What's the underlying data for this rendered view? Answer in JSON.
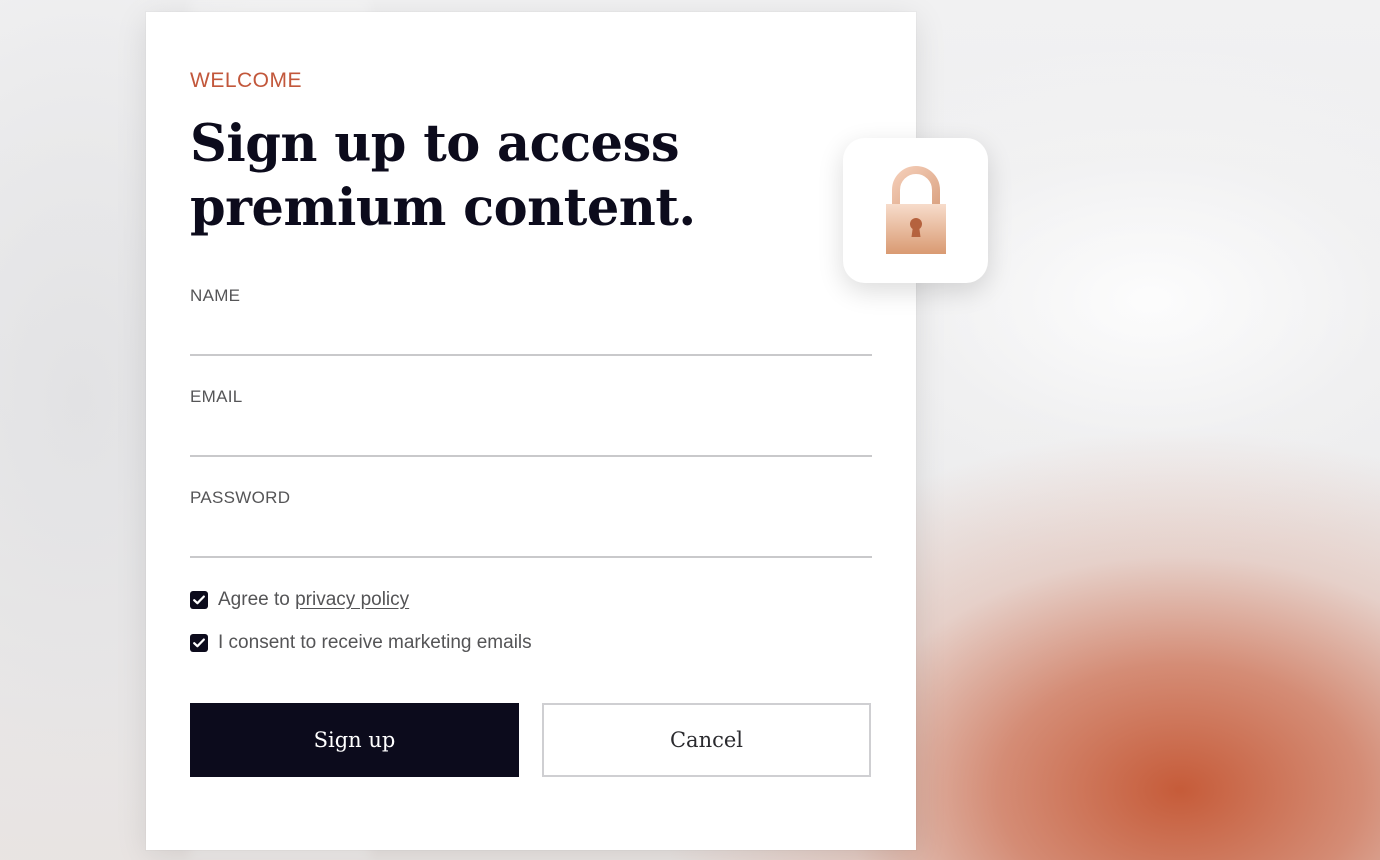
{
  "form": {
    "eyebrow": "WELCOME",
    "title_line1": "Sign up to access",
    "title_line2": "premium content.",
    "fields": [
      {
        "label": "NAME",
        "value": "",
        "placeholder": ""
      },
      {
        "label": "EMAIL",
        "value": "",
        "placeholder": ""
      },
      {
        "label": "PASSWORD",
        "value": "",
        "placeholder": ""
      }
    ],
    "privacy_prefix": "Agree to",
    "privacy_link": "privacy policy",
    "privacy_checked": true,
    "marketing_label": "I consent to receive marketing emails",
    "marketing_checked": true,
    "signup_label": "Sign up",
    "cancel_label": "Cancel"
  },
  "icons": {
    "lock": "padlock-icon",
    "check": "checkmark-icon"
  },
  "colors": {
    "accent": "#c2573b",
    "ink": "#0c0b1c",
    "lock_gradient_top": "#f7dccb",
    "lock_gradient_bottom": "#d99a72",
    "keyhole": "#b5623e"
  }
}
